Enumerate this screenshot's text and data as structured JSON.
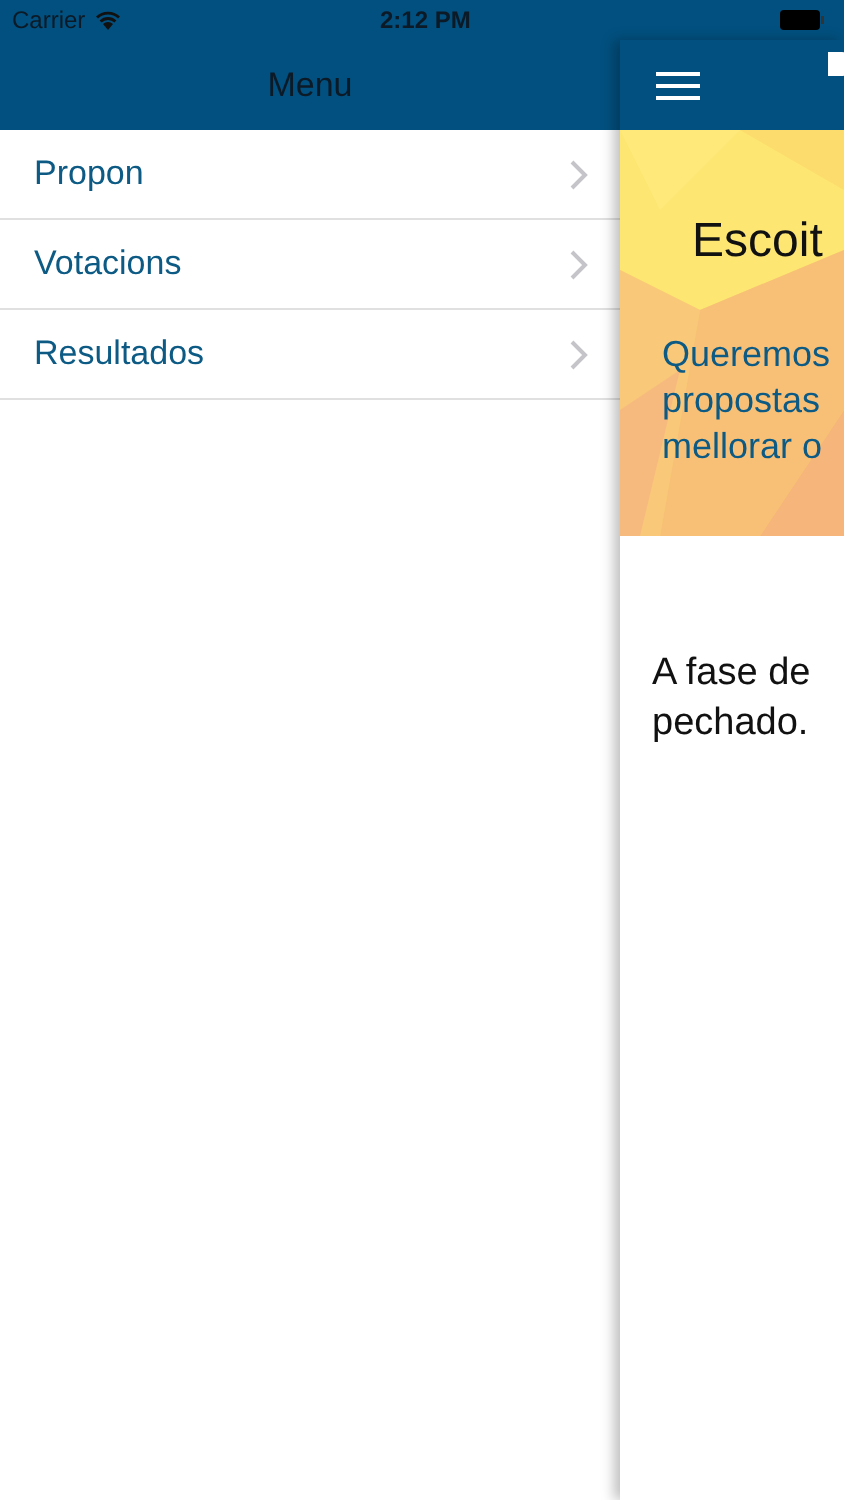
{
  "status_bar": {
    "carrier": "Carrier",
    "time": "2:12 PM"
  },
  "menu": {
    "title": "Menu",
    "items": [
      {
        "label": "Propon"
      },
      {
        "label": "Votacions"
      },
      {
        "label": "Resultados"
      }
    ]
  },
  "content": {
    "banner_title": "Escoit",
    "banner_lines": [
      "Queremos",
      "propostas",
      "mellorar o"
    ],
    "message_lines": [
      "A fase de",
      "pechado."
    ]
  }
}
